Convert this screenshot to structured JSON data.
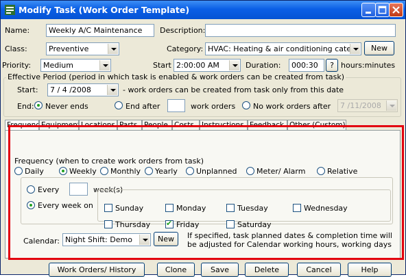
{
  "window": {
    "title": "Modify Task (Work Order Template)",
    "title_color": "#0553d4",
    "highlight_color": "#e3000f"
  },
  "header": {
    "name_label": "Name:",
    "name_value": "Weekly A/C Maintenance",
    "description_label": "Description:",
    "description_value": "",
    "class_label": "Class:",
    "class_value": "Preventive",
    "category_label": "Category:",
    "category_value": "HVAC: Heating & air conditioning cate",
    "new_label": "New",
    "priority_label": "Priority:",
    "priority_value": "Medium",
    "start_label": "Start",
    "start_value": "2:00:00 AM",
    "duration_label": "Duration:",
    "duration_value": "000:30",
    "duration_help": "?",
    "duration_unit": "hours:minutes"
  },
  "effective_period": {
    "legend": "Effective Period (period in which task is enabled & work orders can be created from task)",
    "start_label": "Start:",
    "start_date": "7 / 4 /2008",
    "start_note": "- work orders can be created from task only from this date",
    "end_label": "End:",
    "never_ends": "Never ends",
    "end_after": "End after",
    "end_after_value": "",
    "work_orders": "work orders",
    "no_work_orders_after": "No work orders after",
    "no_work_orders_date": "7 /11/2008"
  },
  "tabs": [
    {
      "label": "Frequency"
    },
    {
      "label": "Equipment"
    },
    {
      "label": "Locations"
    },
    {
      "label": "Parts"
    },
    {
      "label": "People"
    },
    {
      "label": "Costs"
    },
    {
      "label": "Instructions"
    },
    {
      "label": "Feedback"
    },
    {
      "label": "Other (Custom)"
    }
  ],
  "frequency": {
    "legend": "Frequency (when to create work orders from task)",
    "options": [
      "Daily",
      "Weekly",
      "Monthly",
      "Yearly",
      "Unplanned",
      "Meter/ Alarm",
      "Relative"
    ],
    "selected": "Weekly",
    "every_label": "Every",
    "every_value": "",
    "weeks_label": "week(s)",
    "every_week_on_label": "Every week on",
    "days": [
      {
        "label": "Sunday",
        "checked": false
      },
      {
        "label": "Monday",
        "checked": false
      },
      {
        "label": "Tuesday",
        "checked": false
      },
      {
        "label": "Wednesday",
        "checked": false
      },
      {
        "label": "Thursday",
        "checked": false
      },
      {
        "label": "Friday",
        "checked": true
      },
      {
        "label": "Saturday",
        "checked": false
      }
    ],
    "calendar_label": "Calendar:",
    "calendar_value": "Night Shift: Demo",
    "calendar_new": "New",
    "calendar_note_1": "If specified, task planned dates & completion time will",
    "calendar_note_2": "be adjusted for Calendar working hours, working days"
  },
  "footer": {
    "buttons": [
      {
        "label": "Work Orders/ History"
      },
      {
        "label": "Clone"
      },
      {
        "label": "Save"
      },
      {
        "label": "Delete"
      },
      {
        "label": "Cancel"
      },
      {
        "label": "Help"
      }
    ]
  }
}
